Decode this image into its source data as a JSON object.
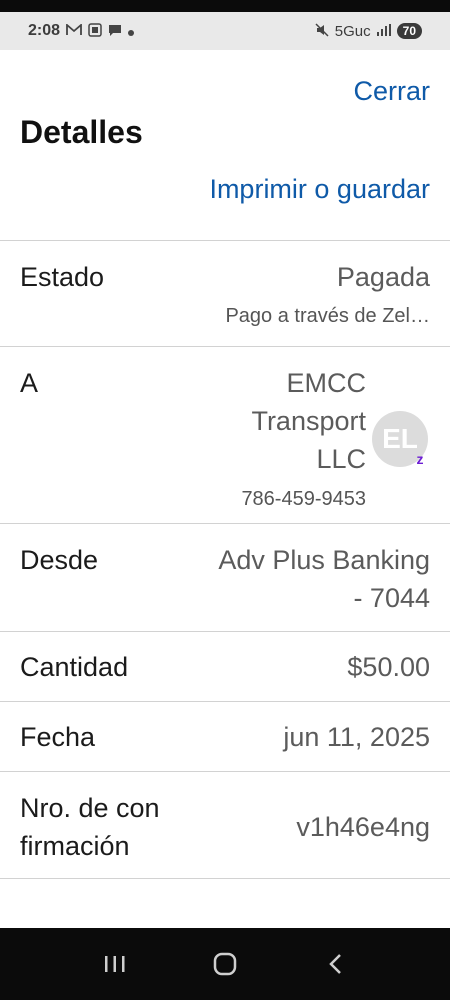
{
  "status_bar": {
    "time": "2:08",
    "network": "5Guc",
    "battery": "70"
  },
  "header": {
    "close_label": "Cerrar",
    "title": "Detalles",
    "print_label": "Imprimir o guardar"
  },
  "details": {
    "status": {
      "label": "Estado",
      "value": "Pagada",
      "sub": "Pago a través de Zel…"
    },
    "to": {
      "label": "A",
      "name_line1": "EMCC",
      "name_line2": "Transport",
      "name_line3": "LLC",
      "phone": "786-459-9453",
      "avatar_initials": "EL",
      "badge": "z"
    },
    "from": {
      "label": "Desde",
      "value_line1": "Adv Plus Banking",
      "value_line2": "- 7044"
    },
    "amount": {
      "label": "Cantidad",
      "value": "$50.00"
    },
    "date": {
      "label": "Fecha",
      "value": "jun 11, 2025"
    },
    "confirmation": {
      "label_line1": "Nro. de con",
      "label_line2": "firmación",
      "value": "v1h46e4ng"
    }
  },
  "icons": {
    "status_left": [
      "gmail-icon",
      "screenshot-icon",
      "chat-icon",
      "dot-icon"
    ],
    "status_right": [
      "mute-icon",
      "signal-icon",
      "battery-icon"
    ],
    "nav": [
      "recent-apps-icon",
      "home-icon",
      "back-icon"
    ]
  }
}
